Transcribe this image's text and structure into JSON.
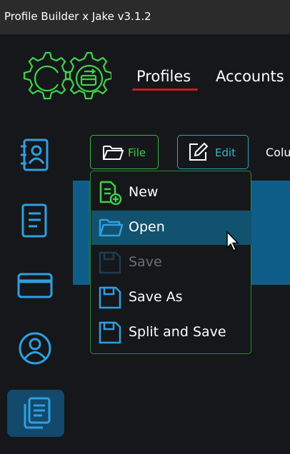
{
  "window": {
    "title": "Profile Builder x Jake v3.1.2"
  },
  "nav": {
    "tabs": [
      {
        "label": "Profiles"
      },
      {
        "label": "Accounts"
      }
    ]
  },
  "toolbar": {
    "file_label": "File",
    "edit_label": "Edit",
    "columns_partial": "Colu"
  },
  "file_menu": {
    "items": [
      {
        "label": "New"
      },
      {
        "label": "Open"
      },
      {
        "label": "Save",
        "disabled": true
      },
      {
        "label": "Save As"
      },
      {
        "label": "Split and Save"
      }
    ],
    "active_index": 1
  },
  "sidebar": {
    "items": [
      {
        "icon": "contacts-book-icon"
      },
      {
        "icon": "document-icon"
      },
      {
        "icon": "credit-card-icon"
      },
      {
        "icon": "user-circle-icon"
      },
      {
        "icon": "copy-documents-icon",
        "active": true
      }
    ]
  },
  "colors": {
    "accent_green": "#3fcf4c",
    "accent_blue": "#2f9fe0",
    "accent_red": "#d0181b",
    "active_bg": "#11526e"
  }
}
